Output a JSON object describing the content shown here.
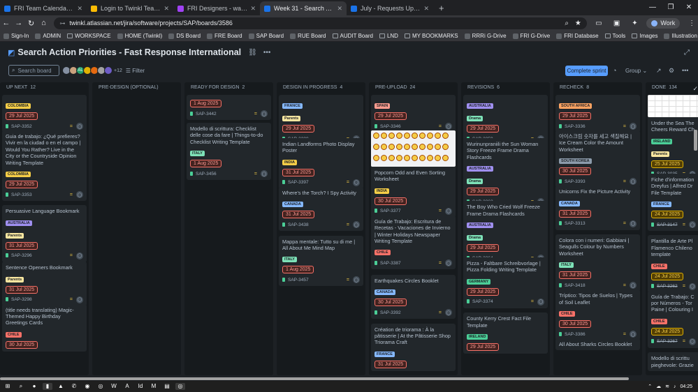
{
  "browser": {
    "tabs": [
      "FRI Team Calendar / Sign In - Co",
      "Login to Twinkl Teaching Reso",
      "FRI Designers - wade.mackint",
      "Week 31 - Search Action Priorit",
      "July - Requests Updates Event"
    ],
    "url": "twinkl.atlassian.net/jira/software/projects/SAP/boards/3586",
    "profile": "Work",
    "bookmarks": [
      "Sign-In",
      "ADMIN",
      "WORKSPACE",
      "HOME (Twinkl)",
      "DS Board",
      "FRE Board",
      "SAP Board",
      "RUE Board",
      "AUDIT Board",
      "LND",
      "MY BOOKMARKS",
      "RRRi G-Drive",
      "FRI G-Drive",
      "FRI Database",
      "Tools",
      "Images",
      "Illustration Search"
    ]
  },
  "page": {
    "title": "Search Action Priorities - Fast Response International",
    "search_placeholder": "Search board",
    "avatars_more": "+12",
    "filter": "Filter",
    "complete_sprint": "Complete sprint",
    "group": "Group"
  },
  "columns": [
    {
      "name": "UP NEXT",
      "count": "12",
      "cards": [
        {
          "epic": "COLOMBIA",
          "ec": "col",
          "date": "29 Jul 2025",
          "key": "SAP-3352"
        },
        {
          "title": "Guia de trabajo: ¿Qué prefieres? Vivir en la ciudad o en el campo | Would You Rather? Live in the City or the Countryside Opinion Writing Template",
          "epic": "COLOMBIA",
          "ec": "col",
          "date": "29 Jul 2025",
          "key": "SAP-3353"
        },
        {
          "title": "Persuasive Language Bookmark",
          "epic": "AUSTRALIA",
          "ec": "aus",
          "epic2": "Parents",
          "date": "31 Jul 2025",
          "key": "SAP-3296"
        },
        {
          "title": "Sentence Openers Bookmark",
          "epic": "Parents",
          "ec": "par",
          "date": "31 Jul 2025",
          "key": "SAP-3298"
        },
        {
          "title": "(title needs translating) Magic-Themed Happy Birthday Greetings Cards",
          "epic": "CHILE",
          "ec": "chi",
          "date": "30 Jul 2025",
          "key": ""
        }
      ]
    },
    {
      "name": "PRE-DESIGN (OPTIONAL)",
      "count": "",
      "cards": []
    },
    {
      "name": "READY FOR DESIGN",
      "count": "2",
      "cards": [
        {
          "date": "1 Aug 2025",
          "key": "SAP-3442"
        },
        {
          "title": "Modello di scrittura: Checklist delle cose da fare | Things-to-do Checklist Writing Template",
          "epic": "ITALY",
          "ec": "ita",
          "date": "1 Aug 2025",
          "key": "SAP-3456"
        }
      ]
    },
    {
      "name": "DESIGN IN PROGRESS",
      "count": "4",
      "cards": [
        {
          "epic": "FRANCE",
          "ec": "fr",
          "epic2": "Parents",
          "date": "29 Jul 2025",
          "key": "SAP-3288"
        },
        {
          "title": "Indian Landforms Photo Display Poster",
          "epic": "INDIA",
          "ec": "ind",
          "date": "31 Jul 2025",
          "key": "SAP-3397"
        },
        {
          "title": "Where's the Torch? I Spy Activity",
          "epic": "CANADA",
          "ec": "can",
          "date": "31 Jul 2025",
          "key": "SAP-3438"
        },
        {
          "title": "Mappa mentale: Tutto su di me | All About Me Mind Map",
          "epic": "ITALY",
          "ec": "ita",
          "date": "1 Aug 2025",
          "key": "SAP-3457"
        }
      ]
    },
    {
      "name": "PRE-UPLOAD",
      "count": "24",
      "cards": [
        {
          "epic": "SPAIN",
          "ec": "spa",
          "date": "29 Jul 2025",
          "key": "SAP-3346"
        },
        {
          "title": "Popcorn Odd and Even Sorting Worksheet",
          "epic": "INDIA",
          "ec": "ind",
          "date": "30 Jul 2025",
          "key": "SAP-3377"
        },
        {
          "title": "Guía de Trabajo: Escritura de Recetas - Vacaciones de Invierno | Winter Holidays Newspaper Writing Template",
          "epic": "CHILE",
          "ec": "chi",
          "date": "",
          "key": "SAP-3387"
        },
        {
          "title": "Earthquakes Circles Booklet",
          "epic": "CANADA",
          "ec": "can",
          "date": "30 Jul 2025",
          "key": "SAP-3392"
        },
        {
          "title": "Création de triorama : À la pâtisserie | At the Pâtisserie Shop Triorama Craft",
          "epic": "FRANCE",
          "ec": "fr",
          "date": "31 Jul 2025",
          "key": ""
        }
      ]
    },
    {
      "name": "REVISIONS",
      "count": "6",
      "cards": [
        {
          "epic": "AUSTRALIA",
          "ec": "aus",
          "epic2": "Drama",
          "date": "29 Jul 2025",
          "key": "SAP-3359"
        },
        {
          "title": "Wurinunpraniili the Sun Woman Story Freeze Frame Drama Flashcards",
          "epic": "AUSTRALIA",
          "ec": "aus",
          "epic2": "Drama",
          "date": "29 Jul 2025",
          "key": "SAP-3362"
        },
        {
          "title": "The Boy Who Cried Wolf Freeze Frame Drama Flashcards",
          "epic": "AUSTRALIA",
          "ec": "aus",
          "epic2": "Drama",
          "date": "29 Jul 2025",
          "key": "SAP-3364"
        },
        {
          "title": "Pizza - Faltbare Schreibvorlage | Pizza Folding Writing Template",
          "epic": "GERMANY",
          "ec": "ger",
          "date": "29 Jul 2025",
          "key": "SAP-3374"
        },
        {
          "title": "County Kerry Crest Fact File Template",
          "epic": "IRELAND",
          "ec": "irl",
          "date": "29 Jul 2025",
          "key": ""
        }
      ]
    },
    {
      "name": "RECHECK",
      "count": "8",
      "cards": [
        {
          "epic": "SOUTH AFRICA",
          "ec": "sa",
          "date": "29 Jul 2025",
          "key": "SAP-3336"
        },
        {
          "title": "아이스크림 숫자를 세고 색칠해요 | Ice Cream Color the Amount Worksheet",
          "epic": "SOUTH KOREA",
          "ec": "sk",
          "date": "30 Jul 2025",
          "key": "SAP-3393"
        },
        {
          "title": "Unicorns Fix the Picture Activity",
          "epic": "CANADA",
          "ec": "can",
          "date": "31 Jul 2025",
          "key": "SAP-3313"
        },
        {
          "title": "Colora con i numeri: Gabbiani | Seagulls Colour by Numbers Worksheet",
          "epic": "ITALY",
          "ec": "ita",
          "date": "31 Jul 2025",
          "key": "SAP-3418"
        },
        {
          "title": "Tríptico: Tipos de Suelos | Types of Soil Leaflet",
          "epic": "CHILE",
          "ec": "chi",
          "date": "30 Jul 2025",
          "key": "SAP-3386"
        },
        {
          "title": "All About Sharks Circles Booklet",
          "key": ""
        }
      ]
    },
    {
      "name": "DONE",
      "count": "134",
      "cards": [
        {
          "title": "Under the Sea The Cheers Reward Ch",
          "epic": "IRELAND",
          "ec": "irl",
          "epic2": "Parents",
          "date": "25 Jul 2025",
          "key": "SAP-3035"
        },
        {
          "title": "Fiche d'information Dreyfus | Alfred Dr File Template",
          "epic": "FRANCE",
          "ec": "fr",
          "date": "24 Jul 2025",
          "key": "SAP-3147"
        },
        {
          "title": "Plantilla de Arte Pl Flamenco Chileno template",
          "epic": "CHILE",
          "ec": "chi",
          "date": "24 Jul 2025",
          "key": "SAP-3262"
        },
        {
          "title": "Guía de Trabajo: C por Números - Tor Paine | Colouring I",
          "epic": "CHILE",
          "ec": "chi",
          "date": "24 Jul 2025",
          "key": "SAP-3267"
        },
        {
          "title": "Modello di scrittu pieghevole: Grazie",
          "key": ""
        }
      ]
    }
  ]
}
